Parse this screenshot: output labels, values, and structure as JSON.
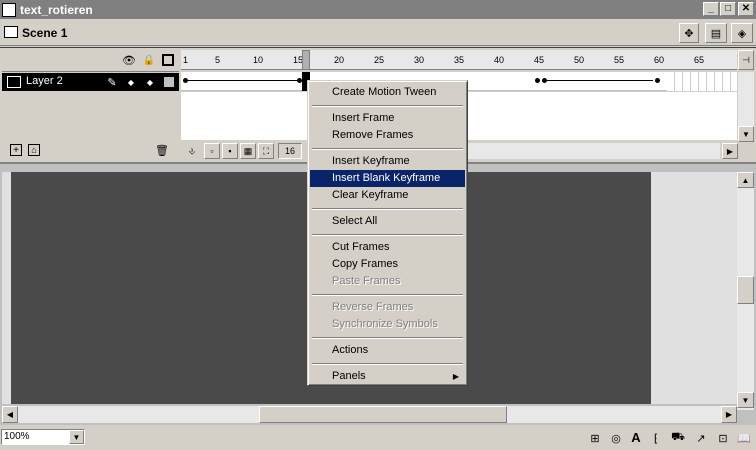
{
  "window": {
    "title": "text_rotieren"
  },
  "scene": {
    "label": "Scene 1"
  },
  "timeline": {
    "layer_name": "Layer 2",
    "ruler_ticks": [
      "1",
      "5",
      "10",
      "15",
      "20",
      "25",
      "30",
      "35",
      "40",
      "45",
      "50",
      "55",
      "60",
      "65"
    ],
    "current_frame": "16"
  },
  "context_menu": {
    "items": [
      {
        "label": "Create Motion Tween",
        "state": "normal"
      },
      {
        "label": "Insert Frame",
        "state": "normal"
      },
      {
        "label": "Remove Frames",
        "state": "normal"
      },
      {
        "label": "Insert Keyframe",
        "state": "normal"
      },
      {
        "label": "Insert Blank Keyframe",
        "state": "selected"
      },
      {
        "label": "Clear Keyframe",
        "state": "normal"
      },
      {
        "label": "Select All",
        "state": "normal"
      },
      {
        "label": "Cut Frames",
        "state": "normal"
      },
      {
        "label": "Copy Frames",
        "state": "normal"
      },
      {
        "label": "Paste Frames",
        "state": "disabled"
      },
      {
        "label": "Reverse Frames",
        "state": "disabled"
      },
      {
        "label": "Synchronize Symbols",
        "state": "disabled"
      },
      {
        "label": "Actions",
        "state": "normal"
      },
      {
        "label": "Panels",
        "state": "normal"
      }
    ]
  },
  "status": {
    "zoom": "100%"
  },
  "icons": [
    "document-icon",
    "minimize-icon",
    "maximize-icon",
    "close-icon",
    "scene-icon",
    "eye-icon",
    "lock-icon",
    "outline-icon",
    "pencil-icon",
    "add-layer-icon",
    "add-guide-icon",
    "trash-icon",
    "submenu-arrow-icon"
  ]
}
